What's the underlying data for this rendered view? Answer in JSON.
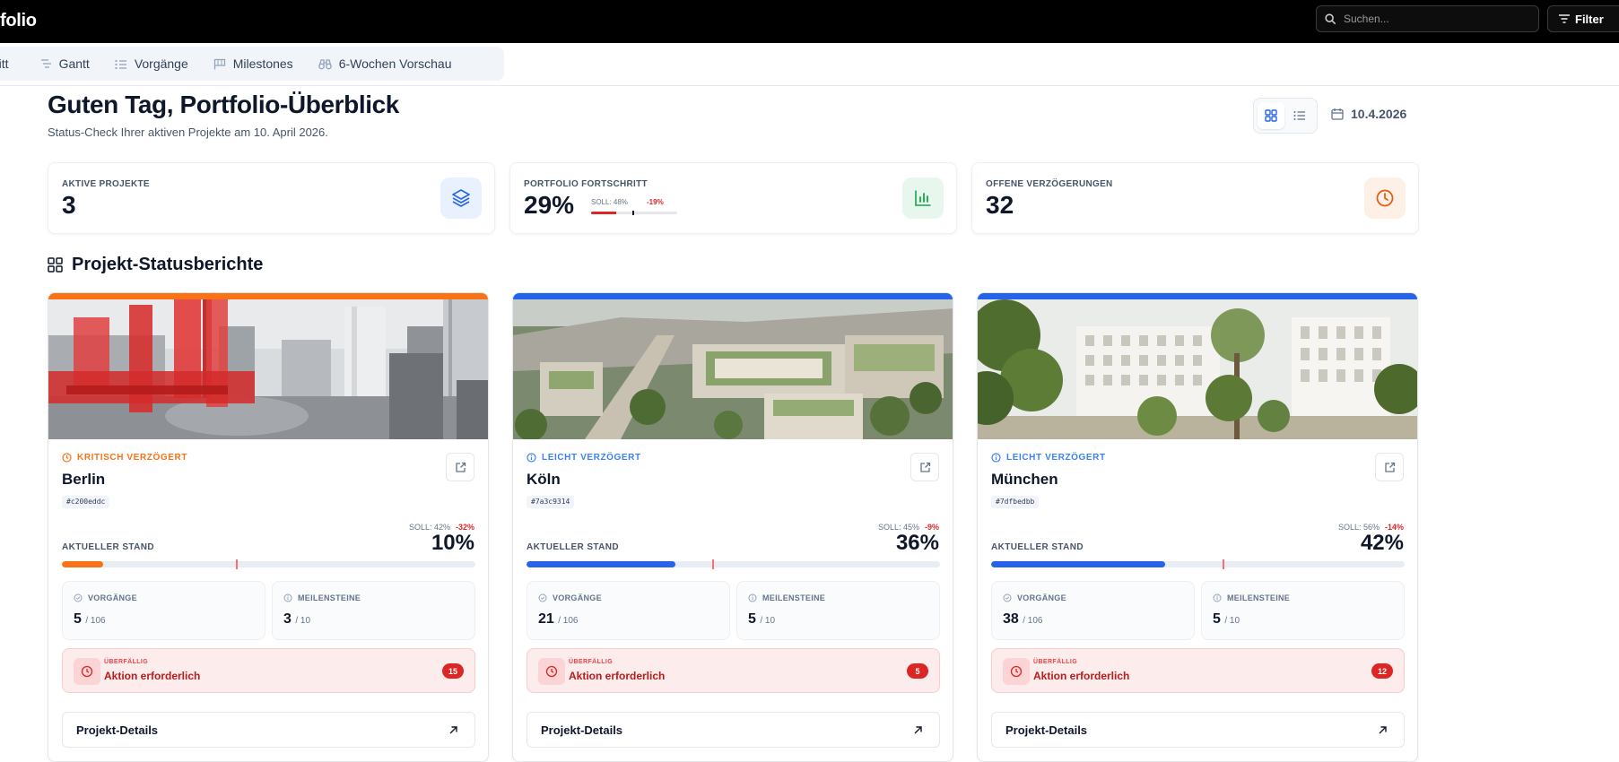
{
  "app": {
    "brand": "folio"
  },
  "search": {
    "placeholder": "Suchen...",
    "value": ""
  },
  "filter": {
    "label": "Filter"
  },
  "tabs": [
    {
      "label": "ritt",
      "icon": "none"
    },
    {
      "label": "Gantt",
      "icon": "gantt-icon"
    },
    {
      "label": "Vorgänge",
      "icon": "list-icon"
    },
    {
      "label": "Milestones",
      "icon": "flag-icon"
    },
    {
      "label": "6-Wochen Vorschau",
      "icon": "binoculars-icon"
    }
  ],
  "header": {
    "greeting": "Guten Tag, Portfolio-Überblick",
    "subtitle": "Status-Check Ihrer aktiven Projekte am 10. April 2026.",
    "date": "10.4.2026",
    "active_view": "grid"
  },
  "kpis": [
    {
      "label": "AKTIVE PROJEKTE",
      "value": "3",
      "icon": "layers-icon",
      "icon_color": "#2563eb",
      "icon_bg": "#eaf1fe"
    },
    {
      "label": "PORTFOLIO FORTSCHRITT",
      "value": "29%",
      "icon": "bar-chart-icon",
      "icon_color": "#16a34a",
      "icon_bg": "#e8f7ee",
      "soll": "SOLL: 48%",
      "deviation": "-19%",
      "progress": 0.29,
      "target": 0.48
    },
    {
      "label": "OFFENE VERZÖGERUNGEN",
      "value": "32",
      "icon": "clock-icon",
      "icon_color": "#ea580c",
      "icon_bg": "#fdf1e7"
    }
  ],
  "section": {
    "title": "Projekt-Statusberichte"
  },
  "projects": [
    {
      "status": "KRITISCH VERZÖGERT",
      "status_color": "#f97316",
      "accent": "#f97316",
      "name": "Berlin",
      "id": "#c200eddc",
      "soll": "SOLL: 42%",
      "deviation": "-32%",
      "stand_label": "AKTUELLER STAND",
      "stand": "10%",
      "progress": 0.1,
      "target": 0.42,
      "bar_color": "#f97316",
      "vorgaenge_label": "VORGÄNGE",
      "vorgaenge": "5",
      "vorgaenge_total": "/ 106",
      "meilensteine_label": "MEILENSTEINE",
      "meilensteine": "3",
      "meilensteine_total": "/ 10",
      "alert_label": "ÜBERFÄLLIG",
      "alert_text": "Aktion erforderlich",
      "alert_count": "15",
      "details_label": "Projekt-Details"
    },
    {
      "status": "LEICHT VERZÖGERT",
      "status_color": "#3b82f6",
      "accent": "#2563eb",
      "name": "Köln",
      "id": "#7a3c9314",
      "soll": "SOLL: 45%",
      "deviation": "-9%",
      "stand_label": "AKTUELLER STAND",
      "stand": "36%",
      "progress": 0.36,
      "target": 0.45,
      "bar_color": "#2563eb",
      "vorgaenge_label": "VORGÄNGE",
      "vorgaenge": "21",
      "vorgaenge_total": "/ 106",
      "meilensteine_label": "MEILENSTEINE",
      "meilensteine": "5",
      "meilensteine_total": "/ 10",
      "alert_label": "ÜBERFÄLLIG",
      "alert_text": "Aktion erforderlich",
      "alert_count": "5",
      "details_label": "Projekt-Details"
    },
    {
      "status": "LEICHT VERZÖGERT",
      "status_color": "#3b82f6",
      "accent": "#2563eb",
      "name": "München",
      "id": "#7dfbedbb",
      "soll": "SOLL: 56%",
      "deviation": "-14%",
      "stand_label": "AKTUELLER STAND",
      "stand": "42%",
      "progress": 0.42,
      "target": 0.56,
      "bar_color": "#2563eb",
      "vorgaenge_label": "VORGÄNGE",
      "vorgaenge": "38",
      "vorgaenge_total": "/ 106",
      "meilensteine_label": "MEILENSTEINE",
      "meilensteine": "5",
      "meilensteine_total": "/ 10",
      "alert_label": "ÜBERFÄLLIG",
      "alert_text": "Aktion erforderlich",
      "alert_count": "12",
      "details_label": "Projekt-Details"
    }
  ]
}
